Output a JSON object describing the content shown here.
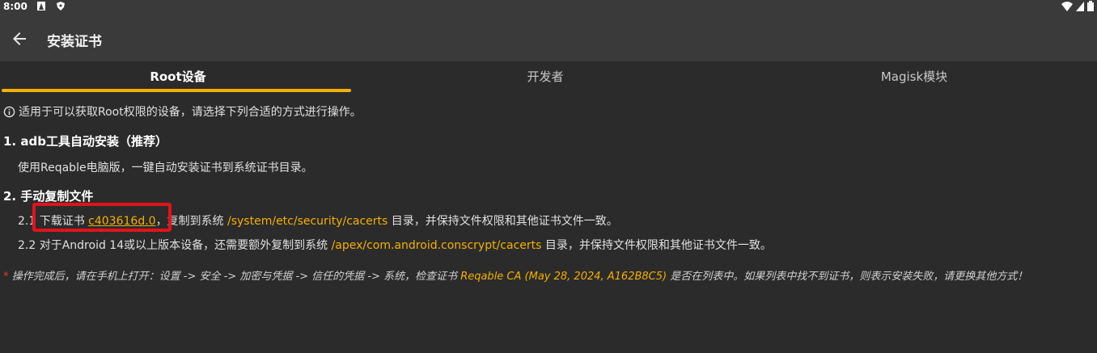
{
  "status_bar": {
    "time": "8:00"
  },
  "app_bar": {
    "title": "安装证书"
  },
  "tabs": [
    {
      "label": "Root设备",
      "active": true
    },
    {
      "label": "开发者",
      "active": false
    },
    {
      "label": "Magisk模块",
      "active": false
    }
  ],
  "info": "适用于可以获取Root权限的设备，请选择下列合适的方式进行操作。",
  "section1": {
    "heading": "1. adb工具自动安装（推荐）",
    "text": "使用Reqable电脑版，一键自动安装证书到系统证书目录。"
  },
  "section2": {
    "heading": "2. 手动复制文件",
    "step1": {
      "prefix": "2.1",
      "text_a": "下载证书",
      "link": "c403616d.0",
      "text_b": "，复制到系统",
      "path": "/system/etc/security/cacerts",
      "text_c": "目录，并保持文件权限和其他证书文件一致。"
    },
    "step2": {
      "prefix": "2.2",
      "text_a": "对于Android 14或以上版本设备，还需要额外复制到系统",
      "path": "/apex/com.android.conscrypt/cacerts",
      "text_c": "目录，并保持文件权限和其他证书文件一致。"
    }
  },
  "note": {
    "star": "*",
    "text_a": "操作完成后，请在手机上打开：设置 -> 安全 -> 加密与凭据 -> 信任的凭据 -> 系统，检查证书",
    "cert": "Reqable CA (May 28, 2024, A162B8C5)",
    "text_b": "是否在列表中。如果列表中找不到证书，则表示安装失败，请更换其他方式！"
  },
  "colors": {
    "accent": "#f5b100",
    "highlight": "#e0141a",
    "background": "#2b2b2b"
  }
}
